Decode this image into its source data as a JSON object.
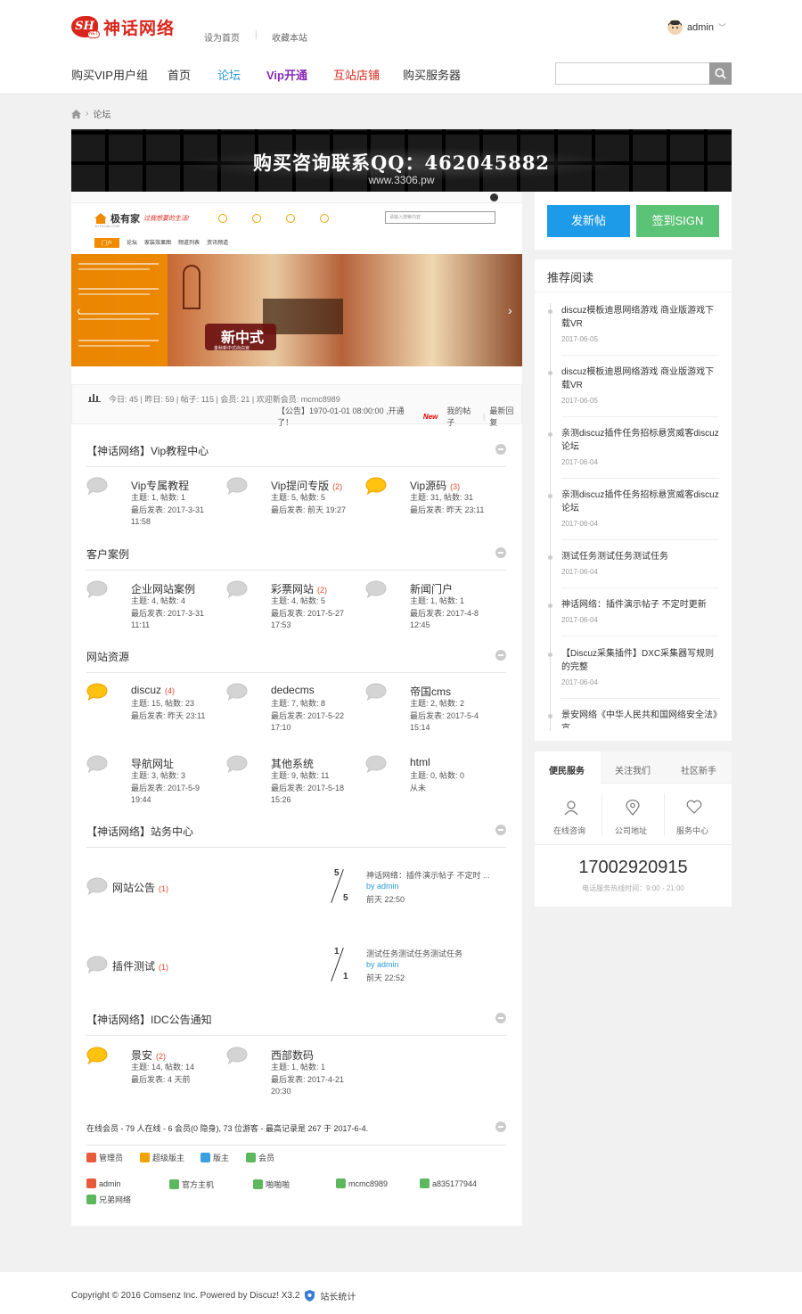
{
  "brand": {
    "badge": "SH",
    "badge_sub": "NET",
    "name": "神话网络"
  },
  "top_links": [
    "设为首页",
    "收藏本站"
  ],
  "user": {
    "name": "admin"
  },
  "nav": [
    {
      "label": "购买VIP用户组",
      "color": "#333333"
    },
    {
      "label": "首页",
      "color": "#333333"
    },
    {
      "label": "论坛",
      "color": "#2a9bd6"
    },
    {
      "label": "Vip开通",
      "color": "#8a2bb5"
    },
    {
      "label": "互站店铺",
      "color": "#d9261c"
    },
    {
      "label": "购买服务器",
      "color": "#333333"
    }
  ],
  "search": {
    "placeholder": ""
  },
  "breadcrumb": {
    "current": "论坛"
  },
  "banner": {
    "line1": "购买咨询联系QQ：462045882",
    "line2": "www.3306.pw"
  },
  "slider": {
    "site_name": "极有家",
    "site_slogan": "过我想要的生活!",
    "site_domain": "JIYOUJIA.COM",
    "tabs": [
      "门户",
      "论坛",
      "家装效果图",
      "频道列表",
      "资讯频道"
    ],
    "search_placeholder": "请输入搜索内容",
    "caption": "新中式",
    "caption_sub": "金秋新中式尚白宫"
  },
  "stats": {
    "text": "今日: 45 | 昨日: 59 | 帖子: 115 | 会员: 21 | 欢迎新会员: mcmc8989",
    "notice": "【公告】1970-01-01 08:00:00 ,开通了！",
    "new_badge": "New",
    "links": [
      "我的帖子",
      "最新回复"
    ]
  },
  "sections": [
    {
      "title": "【神话网络】Vip教程中心",
      "forums": [
        {
          "name": "Vip专属教程",
          "count": "",
          "meta": [
            "主题: 1, 帖数: 1",
            "最后发表: 2017-3-31",
            "11:58"
          ],
          "hot": false
        },
        {
          "name": "Vip提问专版",
          "count": "(2)",
          "meta": [
            "主题: 5, 帖数: 5",
            "最后发表: 前天 19:27"
          ],
          "hot": false
        },
        {
          "name": "Vip源码",
          "count": "(3)",
          "meta": [
            "主题: 31, 帖数: 31",
            "最后发表: 昨天 23:11"
          ],
          "hot": true
        }
      ]
    },
    {
      "title": "客户案例",
      "forums": [
        {
          "name": "企业网站案例",
          "count": "",
          "meta": [
            "主题: 4, 帖数: 4",
            "最后发表: 2017-3-31",
            "11:11"
          ],
          "hot": false
        },
        {
          "name": "彩票网站",
          "count": "(2)",
          "meta": [
            "主题: 4, 帖数: 5",
            "最后发表: 2017-5-27",
            "17:53"
          ],
          "hot": false
        },
        {
          "name": "新闻门户",
          "count": "",
          "meta": [
            "主题: 1, 帖数: 1",
            "最后发表: 2017-4-8",
            "12:45"
          ],
          "hot": false
        }
      ]
    },
    {
      "title": "网站资源",
      "forums": [
        {
          "name": "discuz",
          "count": "(4)",
          "meta": [
            "主题: 15, 帖数: 23",
            "最后发表: 昨天 23:11"
          ],
          "hot": true
        },
        {
          "name": "dedecms",
          "count": "",
          "meta": [
            "主题: 7, 帖数: 8",
            "最后发表: 2017-5-22",
            "17:10"
          ],
          "hot": false
        },
        {
          "name": "帝国cms",
          "count": "",
          "meta": [
            "主题: 2, 帖数: 2",
            "最后发表: 2017-5-4",
            "15:14"
          ],
          "hot": false
        },
        {
          "name": "导航网址",
          "count": "",
          "meta": [
            "主题: 3, 帖数: 3",
            "最后发表: 2017-5-9",
            "19:44"
          ],
          "hot": false
        },
        {
          "name": "其他系统",
          "count": "",
          "meta": [
            "主题: 9, 帖数: 11",
            "最后发表: 2017-5-18",
            "15:26"
          ],
          "hot": false
        },
        {
          "name": "html",
          "count": "",
          "meta": [
            "主题: 0, 帖数: 0",
            "从未"
          ],
          "hot": false
        }
      ]
    },
    {
      "title": "【神话网络】站务中心",
      "threads": [
        {
          "name": "网站公告",
          "count": "(1)",
          "top": "5",
          "bottom": "5",
          "last_title": "神话网络：插件演示帖子 不定时 ...",
          "by": "by  admin",
          "time": "前天 22:50"
        },
        {
          "name": "插件测试",
          "count": "(1)",
          "top": "1",
          "bottom": "1",
          "last_title": "测试任务测试任务测试任务",
          "by": "by  admin",
          "time": "前天 22:52"
        }
      ]
    },
    {
      "title": "【神话网络】IDC公告通知",
      "forums": [
        {
          "name": "景安",
          "count": "(2)",
          "meta": [
            "主题: 14, 帖数: 14",
            "最后发表: 4 天前"
          ],
          "hot": true
        },
        {
          "name": "西部数码",
          "count": "",
          "meta": [
            "主题: 1, 帖数: 1",
            "最后发表: 2017-4-21",
            "20:30"
          ],
          "hot": false
        }
      ]
    }
  ],
  "online": {
    "summary": "在线会员 - 79 人在线 - 6 会员(0 隐身), 73 位游客 - 最高记录是 267 于 2017-6-4.",
    "legend": [
      "管理员",
      "超级版主",
      "版主",
      "会员"
    ],
    "users": [
      "admin",
      "官方主机",
      "啪啪啪",
      "mcmc8989",
      "a835177944",
      "兄弟网络"
    ]
  },
  "sidebar": {
    "post_button": "发新帖",
    "sign_button": "签到SIGN",
    "recommend_title": "推荐阅读",
    "recommend": [
      {
        "title": "discuz模板迪恩网络游戏 商业版游戏下载VR",
        "date": "2017-06-05"
      },
      {
        "title": "discuz模板迪恩网络游戏 商业版游戏下载VR",
        "date": "2017-06-05"
      },
      {
        "title": "亲测discuz插件任务招标悬赏威客discuz论坛",
        "date": "2017-06-04"
      },
      {
        "title": "亲测discuz插件任务招标悬赏威客discuz论坛",
        "date": "2017-06-04"
      },
      {
        "title": "测试任务测试任务测试任务",
        "date": "2017-06-04"
      },
      {
        "title": "神话网络：插件演示帖子 不定时更新",
        "date": "2017-06-04"
      },
      {
        "title": "【Discuz采集插件】DXC采集器写规则的完整",
        "date": "2017-06-04"
      },
      {
        "title": "景安网络《中华人民共和国网络安全法》宣",
        "date": ""
      }
    ],
    "service_tabs": [
      "便民服务",
      "关注我们",
      "社区新手"
    ],
    "services": [
      "在线咨询",
      "公司地址",
      "服务中心"
    ],
    "phone": "17002920915",
    "hours": "电话服务热线时间：9:00 - 21:00"
  },
  "footer": {
    "text": "Copyright © 2016 Comsenz Inc. Powered by Discuz! X3.2",
    "stat": "站长统计"
  }
}
